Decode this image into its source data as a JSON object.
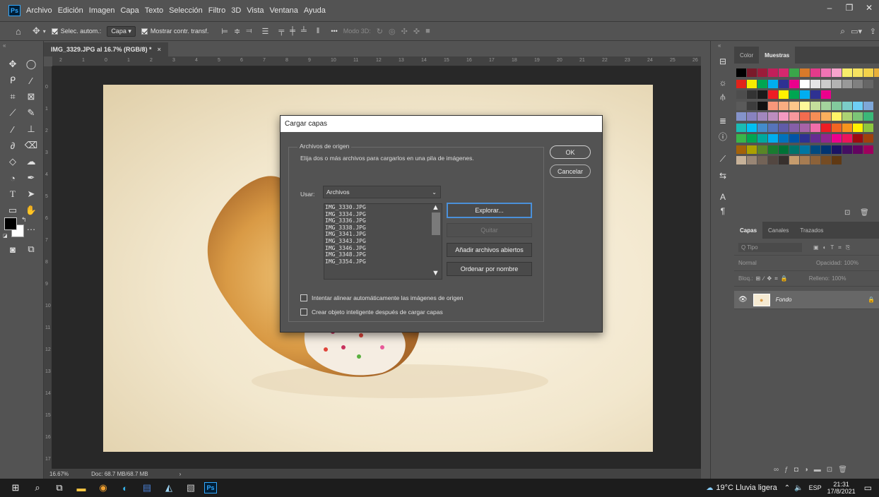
{
  "app": {
    "logo": "Ps",
    "menu": [
      "Archivo",
      "Edición",
      "Imagen",
      "Capa",
      "Texto",
      "Selección",
      "Filtro",
      "3D",
      "Vista",
      "Ventana",
      "Ayuda"
    ],
    "window_controls": [
      "–",
      "❐",
      "✕"
    ]
  },
  "options": {
    "auto_select_label": "Selec. autom.:",
    "auto_select_value": "Capa",
    "show_transform_label": "Mostrar contr. transf.",
    "more": "•••",
    "mode3d": "Modo 3D:"
  },
  "document": {
    "tab_title": "IMG_3329.JPG al 16.7% (RGB/8) *",
    "tab_close": "×",
    "zoom": "16.67%",
    "doc_info": "Doc: 68.7 MB/68.7 MB",
    "ruler_h": [
      "2",
      "1",
      "0",
      "1",
      "2",
      "3",
      "4",
      "5",
      "6",
      "7",
      "8",
      "9",
      "10",
      "11",
      "12",
      "13",
      "14",
      "15",
      "16",
      "17",
      "18",
      "19",
      "20",
      "21",
      "22",
      "23",
      "24",
      "25",
      "26"
    ],
    "ruler_v": [
      "0",
      "1",
      "2",
      "3",
      "4",
      "5",
      "6",
      "7",
      "8",
      "9",
      "10",
      "11",
      "12",
      "13",
      "14",
      "15",
      "16",
      "17"
    ]
  },
  "dialog": {
    "title": "Cargar capas",
    "group_label": "Archivos de origen",
    "description": "Elija dos o más archivos para cargarlos en una pila de imágenes.",
    "use_label": "Usar:",
    "use_value": "Archivos",
    "files": [
      "IMG_3330.JPG",
      "IMG_3334.JPG",
      "IMG_3336.JPG",
      "IMG_3338.JPG",
      "IMG_3341.JPG",
      "IMG_3343.JPG",
      "IMG_3346.JPG",
      "IMG_3348.JPG",
      "IMG_3354.JPG"
    ],
    "browse": "Explorar...",
    "remove": "Quitar",
    "add_open": "Añadir archivos abiertos",
    "sort_name": "Ordenar por nombre",
    "ok": "OK",
    "cancel": "Cancelar",
    "align_option": "Intentar alinear automáticamente las imágenes de origen",
    "smart_object_option": "Crear objeto inteligente después de cargar capas"
  },
  "panels": {
    "color_tab": "Color",
    "swatches_tab": "Muestras",
    "layers_tab": "Capas",
    "channels_tab": "Canales",
    "paths_tab": "Trazados",
    "kind_filter": "Q Tipo",
    "blend_mode": "Normal",
    "opacity_label": "Opacidad:",
    "opacity_value": "100%",
    "lock_label": "Bloq.:",
    "fill_label": "Relleno:",
    "fill_value": "100%",
    "layer_name": "Fondo"
  },
  "taskbar": {
    "weather": "19°C  Lluvia ligera",
    "lang": "ESP",
    "time": "21:31",
    "date": "17/8/2021"
  },
  "colors": {
    "ui_bg": "#535353",
    "canvas_bg": "#282828",
    "accent": "#31a8ff"
  }
}
